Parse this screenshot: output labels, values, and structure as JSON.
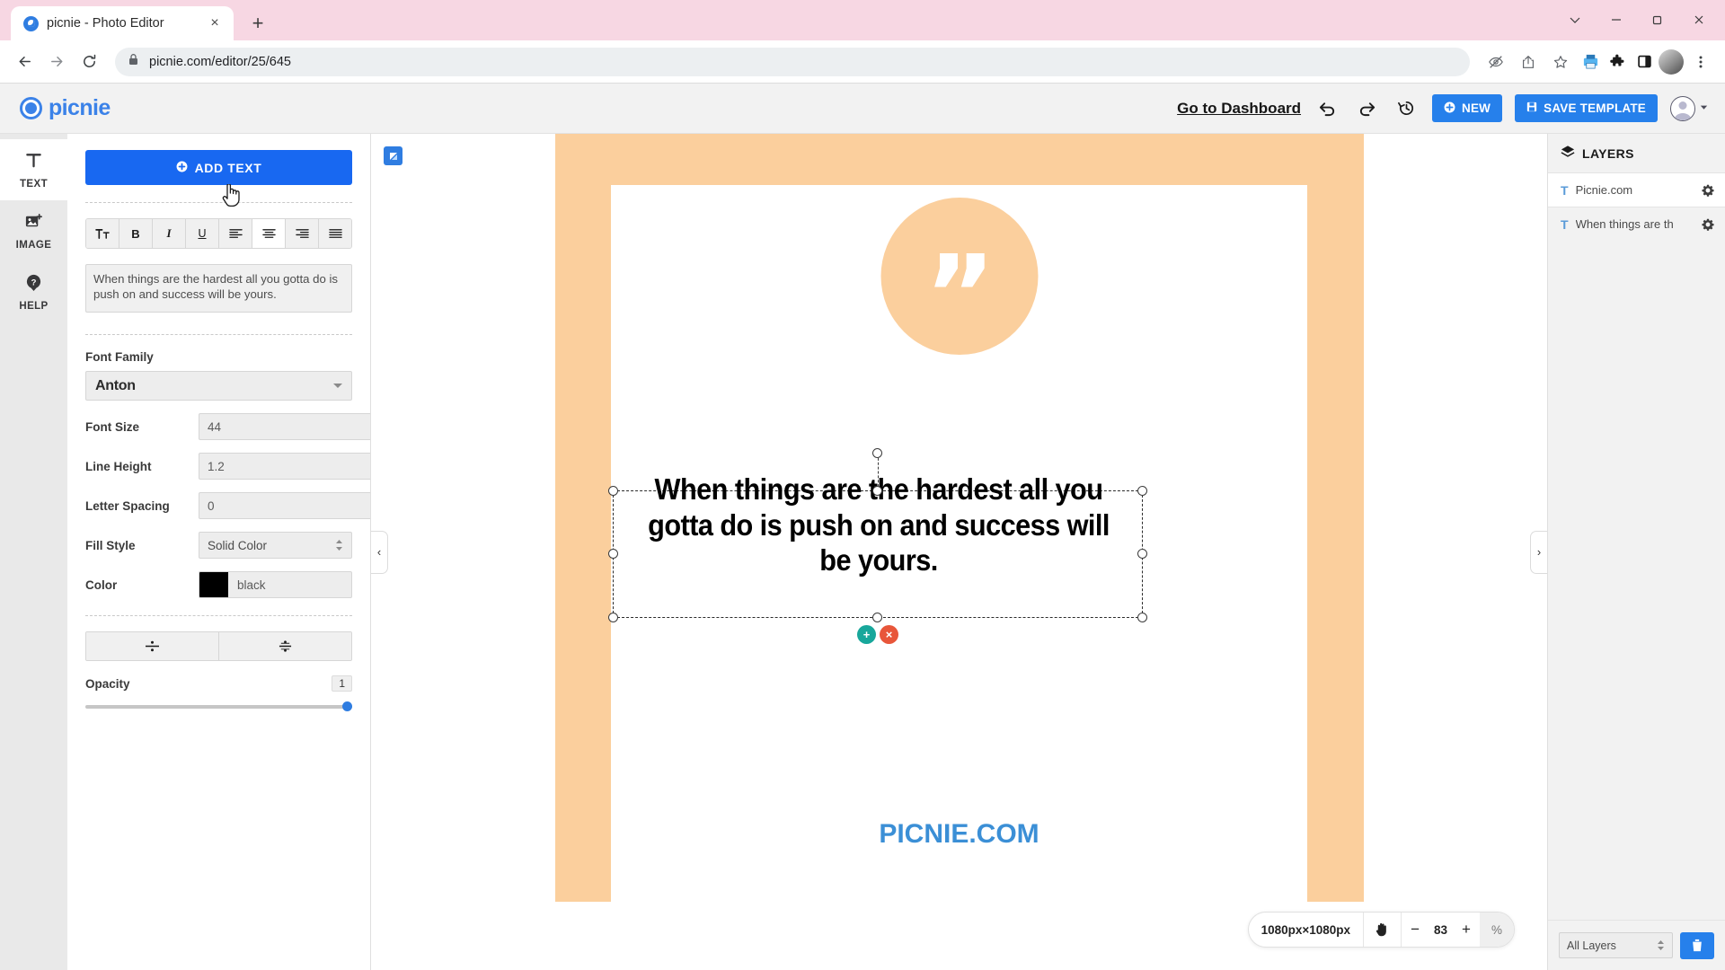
{
  "browser": {
    "tab": {
      "title": "picnie - Photo Editor",
      "favicon": "picnie-favicon",
      "close_label": "×"
    },
    "new_tab_label": "+",
    "window_controls": {
      "chevron": "⌄",
      "minimize": "─",
      "maximize": "❐",
      "close": "✕"
    },
    "nav": {
      "back": "←",
      "forward": "→",
      "reload": "⟳"
    },
    "omnibox": {
      "url": "picnie.com/editor/25/645",
      "lock_icon": "lock-icon"
    },
    "toolbar_icons": [
      "no-eye-icon",
      "share-icon",
      "bookmark-star-icon",
      "print-icon",
      "extensions-puzzle-icon",
      "sidepanel-icon",
      "profile-avatar-icon",
      "chrome-menu-icon"
    ]
  },
  "app": {
    "logo_text": "picnie",
    "dashboard_link": "Go to Dashboard",
    "history_icons": [
      "undo-icon",
      "redo-icon",
      "version-history-icon"
    ],
    "new_button": "NEW",
    "save_button": "SAVE TEMPLATE"
  },
  "rail": {
    "items": [
      {
        "label": "TEXT",
        "icon": "text-icon",
        "active": true
      },
      {
        "label": "IMAGE",
        "icon": "image-icon",
        "active": false
      },
      {
        "label": "HELP",
        "icon": "help-icon",
        "active": false
      }
    ]
  },
  "panel": {
    "add_text_button": "ADD TEXT",
    "format_buttons": [
      {
        "name": "text-transform",
        "glyph": "Tt"
      },
      {
        "name": "bold",
        "glyph": "B"
      },
      {
        "name": "italic",
        "glyph": "I"
      },
      {
        "name": "underline",
        "glyph": "U"
      },
      {
        "name": "align-left",
        "glyph": "☰"
      },
      {
        "name": "align-center",
        "glyph": "☰"
      },
      {
        "name": "align-right",
        "glyph": "☰"
      },
      {
        "name": "align-justify",
        "glyph": "☰"
      }
    ],
    "textarea_value": "When things are the hardest all you gotta do is push on and success will be yours.",
    "font_family_label": "Font Family",
    "font_family_value": "Anton",
    "font_size_label": "Font Size",
    "font_size_value": "44",
    "line_height_label": "Line Height",
    "line_height_value": "1.2",
    "letter_spacing_label": "Letter Spacing",
    "letter_spacing_value": "0",
    "fill_style_label": "Fill Style",
    "fill_style_value": "Solid Color",
    "color_label": "Color",
    "color_value": "black",
    "color_hex": "#000000",
    "vertical_center_glyph": "⨟",
    "horizontal_center_glyph": "÷",
    "opacity_label": "Opacity",
    "opacity_value": "1"
  },
  "canvas": {
    "artboard_quote_glyph": "”",
    "selected_text": "When things are the hardest all you gotta do is push on and success will be yours.",
    "brand_text": "PICNIE.COM",
    "object_add_glyph": "+",
    "object_delete_glyph": "×",
    "resize_tool_icon": "resize-canvas-icon",
    "collapse_left_glyph": "‹",
    "collapse_right_glyph": "›",
    "background_color": "#fbcf9d",
    "brand_color": "#3b8fd6"
  },
  "zoombar": {
    "dimensions": "1080px×1080px",
    "pan_icon": "hand-pan-icon",
    "minus": "−",
    "zoom_value": "83",
    "plus": "+",
    "percent": "%"
  },
  "layers": {
    "title": "LAYERS",
    "items": [
      {
        "type_glyph": "T",
        "name": "Picnie.com",
        "selected": true
      },
      {
        "type_glyph": "T",
        "name": "When things are th",
        "selected": false
      }
    ],
    "filter_value": "All Layers",
    "delete_icon": "trash-icon"
  }
}
